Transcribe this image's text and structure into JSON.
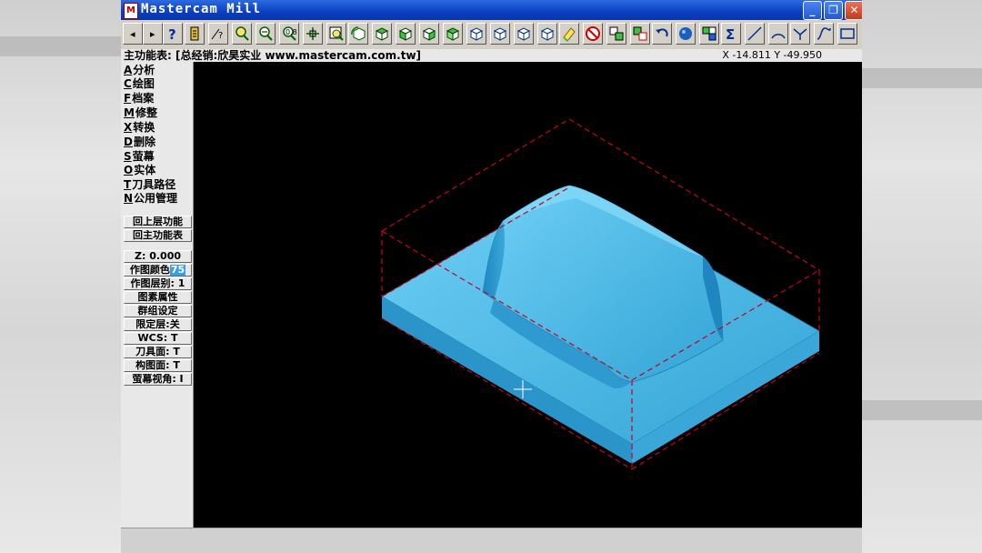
{
  "window": {
    "title": "Mastercam Mill",
    "icon_label": "M"
  },
  "status": {
    "menu_title": "主功能表: [总经销:欣昊实业 www.mastercam.com.tw]",
    "coords": "X -14.811  Y -49.950"
  },
  "menu": [
    {
      "key": "A",
      "label": "分析"
    },
    {
      "key": "C",
      "label": "绘图"
    },
    {
      "key": "F",
      "label": "档案"
    },
    {
      "key": "M",
      "label": "修整"
    },
    {
      "key": "X",
      "label": "转换"
    },
    {
      "key": "D",
      "label": "删除"
    },
    {
      "key": "S",
      "label": "萤幕"
    },
    {
      "key": "O",
      "label": "实体"
    },
    {
      "key": "T",
      "label": "刀具路径"
    },
    {
      "key": "N",
      "label": "公用管理"
    }
  ],
  "nav_buttons": [
    "回上层功能",
    "回主功能表"
  ],
  "settings": {
    "z": "Z:  0.000",
    "color_label": "作图颜色",
    "color_value": "75",
    "level": "作图层别: 1",
    "attributes": "图素属性",
    "group": "群组设定",
    "limit_level": "限定层:关",
    "wcs": "WCS:  T",
    "tool_plane": "刀具面: T",
    "construction_plane": "构图面: T",
    "screen_view": "萤幕视角: I"
  },
  "toolbar_icons": [
    "back-arrow-icon",
    "forward-arrow-icon",
    "help-icon",
    "memory-icon",
    "analyze-icon",
    "zoom-window-icon",
    "zoom-out-icon",
    "zoom-in-icon",
    "pan-icon",
    "zoom-select-icon",
    "rotate-cube-icon",
    "cube-top-icon",
    "cube-front-icon",
    "cube-side-icon",
    "cube-iso-icon",
    "cube-view-a-icon",
    "cube-view-b-icon",
    "cube-view-c-icon",
    "cube-view-d-icon",
    "eraser-icon",
    "blank-icon",
    "transform-a-icon",
    "transform-b-icon",
    "undo-icon",
    "sphere-shade-icon",
    "layers-icon",
    "sigma-icon",
    "line-icon",
    "arc-icon",
    "chamfer-icon",
    "spline-icon",
    "rectangle-icon"
  ],
  "colors": {
    "model_fill": "#3aa7d8",
    "model_edge": "#1e7fb0",
    "bbox_dashed": "#c8001e",
    "viewport_bg": "#000000",
    "titlebar": "#0a3fc0"
  }
}
